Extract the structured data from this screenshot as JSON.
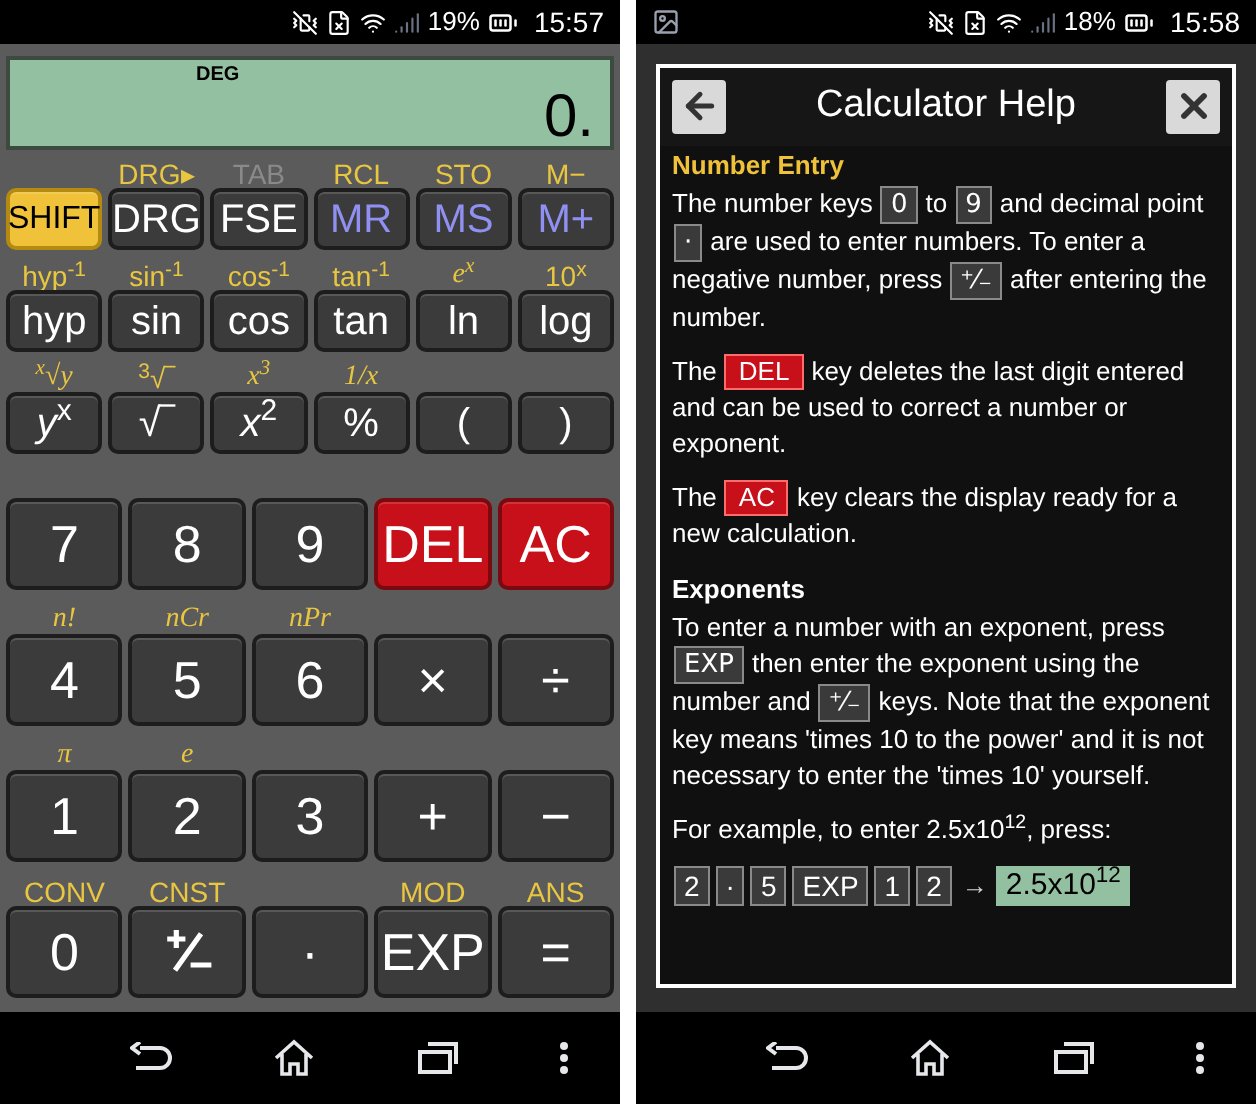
{
  "left": {
    "status_bar": {
      "battery": "19%",
      "time": "15:57"
    },
    "display": {
      "mode": "DEG",
      "value": "0."
    },
    "upper_keys": [
      {
        "label": "SHIFT",
        "kind": "shift"
      },
      {
        "label": "DRG",
        "kind": "plain",
        "shift": {
          "text": "DRG▸",
          "disabled": false,
          "italic": false
        }
      },
      {
        "label": "FSE",
        "kind": "plain",
        "shift": {
          "text": "TAB",
          "disabled": true,
          "italic": false
        }
      },
      {
        "label": "MR",
        "kind": "memory",
        "shift": {
          "text": "RCL",
          "disabled": false,
          "italic": false
        }
      },
      {
        "label": "MS",
        "kind": "memory",
        "shift": {
          "text": "STO",
          "disabled": false,
          "italic": false
        }
      },
      {
        "label": "M+",
        "kind": "memory",
        "shift": {
          "text": "M−",
          "disabled": false,
          "italic": false
        }
      },
      {
        "label": "hyp",
        "kind": "plain",
        "shift": {
          "text": "hyp$^{-1}$",
          "disabled": false,
          "italic": false
        }
      },
      {
        "label": "sin",
        "kind": "plain",
        "shift": {
          "text": "sin$^{-1}$",
          "disabled": false,
          "italic": false
        }
      },
      {
        "label": "cos",
        "kind": "plain",
        "shift": {
          "text": "cos$^{-1}$",
          "disabled": false,
          "italic": false
        }
      },
      {
        "label": "tan",
        "kind": "plain",
        "shift": {
          "text": "tan$^{-1}$",
          "disabled": false,
          "italic": false
        }
      },
      {
        "label": "ln",
        "kind": "plain",
        "shift": {
          "text": "e$^{x}$",
          "disabled": false,
          "italic": true
        }
      },
      {
        "label": "log",
        "kind": "plain",
        "shift": {
          "text": "10$^{x}$",
          "disabled": false,
          "italic": false
        }
      },
      {
        "label": "*y*$^{x}$",
        "kind": "plain",
        "shift": {
          "text": "$^{x}$√y",
          "disabled": false,
          "italic": true
        }
      },
      {
        "label": "√‾",
        "kind": "plain",
        "shift": {
          "text": "$^{3}$√‾",
          "disabled": false,
          "italic": false
        }
      },
      {
        "label": "*x*$^{2}$",
        "kind": "plain",
        "shift": {
          "text": "x$^{3}$",
          "disabled": false,
          "italic": true
        }
      },
      {
        "label": "%",
        "kind": "plain",
        "shift": {
          "text": "1/x",
          "disabled": false,
          "italic": true
        }
      },
      {
        "label": "(",
        "kind": "plain"
      },
      {
        "label": ")",
        "kind": "plain"
      }
    ],
    "lower_keys": [
      {
        "label": "7",
        "kind": "plain"
      },
      {
        "label": "8",
        "kind": "plain"
      },
      {
        "label": "9",
        "kind": "plain"
      },
      {
        "label": "DEL",
        "kind": "danger"
      },
      {
        "label": "AC",
        "kind": "danger"
      },
      {
        "label": "4",
        "kind": "plain",
        "shift": {
          "text": "n!",
          "disabled": false,
          "italic": true
        }
      },
      {
        "label": "5",
        "kind": "plain",
        "shift": {
          "text": "nCr",
          "disabled": false,
          "italic": true
        }
      },
      {
        "label": "6",
        "kind": "plain",
        "shift": {
          "text": "nPr",
          "disabled": false,
          "italic": true
        }
      },
      {
        "label": "×",
        "kind": "plain"
      },
      {
        "label": "÷",
        "kind": "plain"
      },
      {
        "label": "1",
        "kind": "plain",
        "shift": {
          "text": "π",
          "disabled": false,
          "italic": true
        }
      },
      {
        "label": "2",
        "kind": "plain",
        "shift": {
          "text": "e",
          "disabled": false,
          "italic": true
        }
      },
      {
        "label": "3",
        "kind": "plain"
      },
      {
        "label": "+",
        "kind": "plain"
      },
      {
        "label": "−",
        "kind": "plain"
      },
      {
        "label": "0",
        "kind": "plain",
        "shift": {
          "text": "CONV",
          "disabled": false,
          "italic": false
        }
      },
      {
        "kind": "plusminus",
        "shift": {
          "text": "CNST",
          "disabled": false,
          "italic": false
        }
      },
      {
        "label": "·",
        "kind": "plain"
      },
      {
        "label": "EXP",
        "kind": "plain",
        "shift": {
          "text": "MOD",
          "disabled": false,
          "italic": false
        }
      },
      {
        "label": "=",
        "kind": "plain",
        "shift": {
          "text": "ANS",
          "disabled": false,
          "italic": false
        }
      }
    ]
  },
  "right": {
    "status_bar": {
      "battery": "18%",
      "time": "15:58"
    },
    "dialog": {
      "title": "Calculator Help",
      "sections": [
        {
          "heading": "Number Entry",
          "accent": true,
          "paragraphs": [
            {
              "kind": "sentence",
              "parts": [
                {
                  "kind": "text",
                  "text": "The number keys"
                },
                {
                  "kind": "key",
                  "text": "0"
                },
                {
                  "kind": "text",
                  "text": "to"
                },
                {
                  "kind": "key",
                  "text": "9"
                },
                {
                  "kind": "text",
                  "text": "and decimal point"
                },
                {
                  "kind": "key",
                  "text": "·"
                },
                {
                  "kind": "text",
                  "text": "are used to enter numbers. To enter a negative number, press"
                },
                {
                  "kind": "key",
                  "text": "⁺⁄₋"
                },
                {
                  "kind": "text",
                  "text": "after entering the number."
                }
              ]
            },
            {
              "kind": "sentence",
              "parts": [
                {
                  "kind": "text",
                  "text": "The"
                },
                {
                  "kind": "danger",
                  "text": "DEL"
                },
                {
                  "kind": "text",
                  "text": "key deletes the last digit entered and can be used to correct a number or exponent."
                }
              ]
            },
            {
              "kind": "sentence",
              "parts": [
                {
                  "kind": "text",
                  "text": "The"
                },
                {
                  "kind": "danger",
                  "text": "AC"
                },
                {
                  "kind": "text",
                  "text": "key clears the display ready for a new calculation."
                }
              ]
            }
          ]
        },
        {
          "heading": "Exponents",
          "accent": false,
          "paragraphs": [
            {
              "kind": "sentence",
              "parts": [
                {
                  "kind": "text",
                  "text": "To enter a number with an exponent, press"
                },
                {
                  "kind": "key",
                  "text": "EXP"
                },
                {
                  "kind": "text",
                  "text": "then enter the exponent using the number and"
                },
                {
                  "kind": "key",
                  "text": "⁺⁄₋"
                },
                {
                  "kind": "text",
                  "text": "keys. Note that the exponent key means 'times 10 to the power' and it is not necessary to enter the 'times 10' yourself."
                }
              ]
            },
            {
              "kind": "sentence",
              "parts": [
                {
                  "kind": "text",
                  "text": "For example, to enter 2.5x10$^{12}$, press:"
                }
              ]
            },
            {
              "kind": "key_sequence",
              "parts": [
                {
                  "kind": "key",
                  "text": "2"
                },
                {
                  "kind": "key",
                  "text": "·"
                },
                {
                  "kind": "key",
                  "text": "5"
                },
                {
                  "kind": "key",
                  "text": "EXP"
                },
                {
                  "kind": "key",
                  "text": "1"
                },
                {
                  "kind": "key",
                  "text": "2"
                },
                {
                  "kind": "arrow",
                  "text": "→"
                },
                {
                  "kind": "result",
                  "text": "2.5x10$^{12}$"
                }
              ]
            }
          ]
        }
      ]
    }
  }
}
